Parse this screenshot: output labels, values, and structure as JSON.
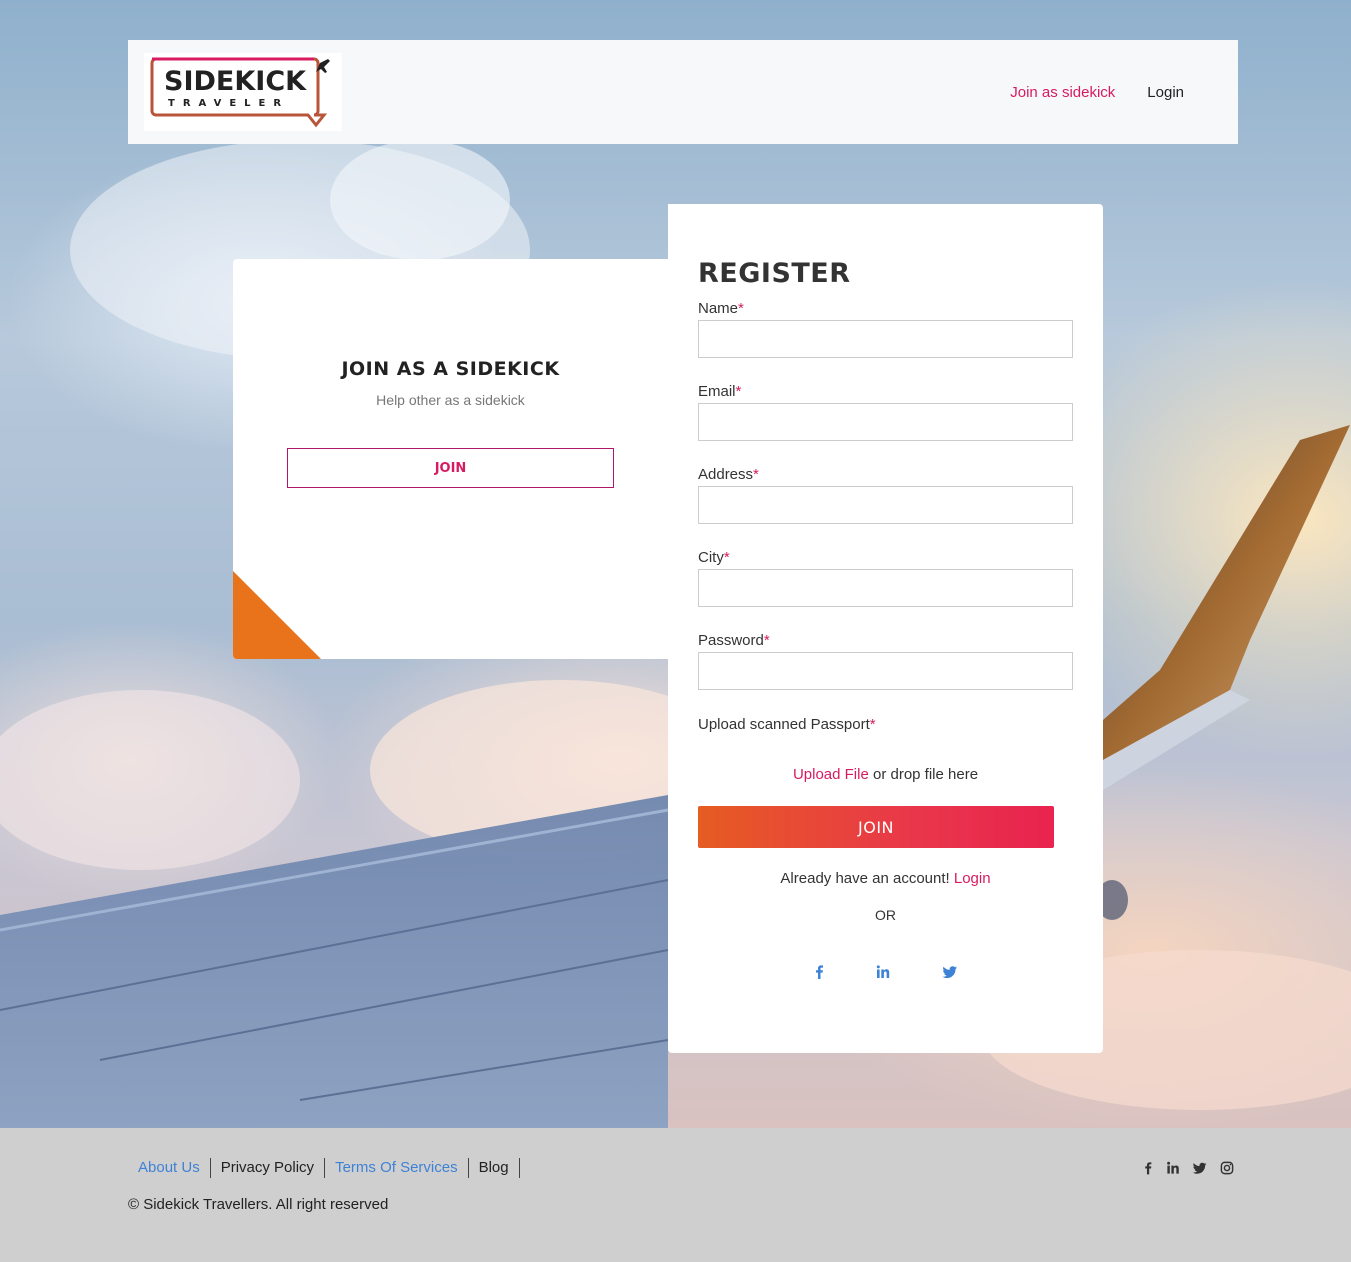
{
  "brand": {
    "logo_main": "SIDEKICK",
    "logo_sub": "TRAVELER",
    "accent": "#d81b60",
    "orange": "#e8731a"
  },
  "nav": {
    "join_sidekick": "Join as sidekick",
    "login": "Login"
  },
  "join_card": {
    "title": "JOIN AS A SIDEKICK",
    "subtitle": "Help other as a sidekick",
    "button": "JOIN"
  },
  "register": {
    "title": "REGISTER",
    "fields": [
      {
        "label": "Name",
        "required": "*",
        "value": ""
      },
      {
        "label": "Email",
        "required": "*",
        "value": ""
      },
      {
        "label": "Address",
        "required": "*",
        "value": ""
      },
      {
        "label": "City",
        "required": "*",
        "value": ""
      },
      {
        "label": "Password",
        "required": "*",
        "value": ""
      }
    ],
    "upload_label": "Upload scanned Passport",
    "upload_required": "*",
    "upload_link": "Upload File",
    "upload_rest": " or drop file here",
    "submit": "JOIN",
    "already_text": "Already have an account! ",
    "already_link": "Login",
    "or": "OR",
    "social_icons": [
      "facebook-icon",
      "linkedin-icon",
      "twitter-icon"
    ]
  },
  "footer": {
    "links": [
      "About Us",
      "Privacy Policy",
      "Terms Of Services",
      "Blog"
    ],
    "copyright": "© Sidekick Travellers. All right reserved",
    "social_icons": [
      "facebook-icon",
      "linkedin-icon",
      "twitter-icon",
      "instagram-icon"
    ]
  }
}
